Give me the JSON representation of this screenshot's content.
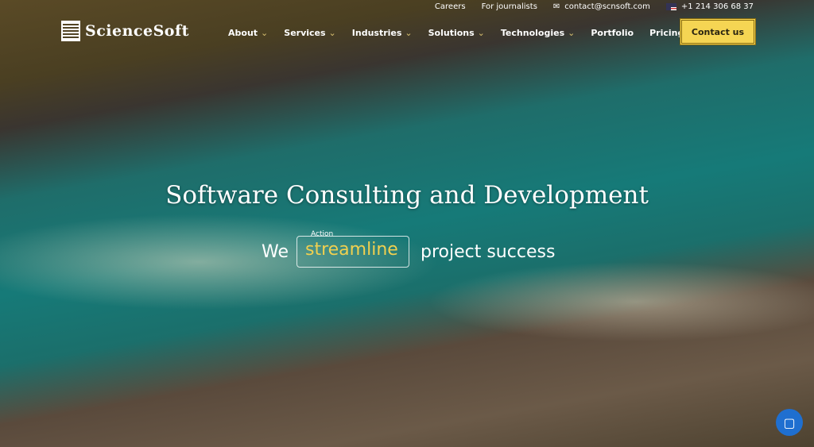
{
  "topbar": {
    "careers": "Careers",
    "journalists": "For journalists",
    "email": "contact@scnsoft.com",
    "phone": "+1 214 306 68 37"
  },
  "logo": "ScienceSoft",
  "nav": [
    {
      "label": "About",
      "dropdown": true
    },
    {
      "label": "Services",
      "dropdown": true
    },
    {
      "label": "Industries",
      "dropdown": true
    },
    {
      "label": "Solutions",
      "dropdown": true
    },
    {
      "label": "Technologies",
      "dropdown": true
    },
    {
      "label": "Portfolio",
      "dropdown": false
    },
    {
      "label": "Pricing",
      "dropdown": false
    }
  ],
  "contact_button": "Contact us",
  "hero": {
    "title": "Software Consulting and Development",
    "prefix": "We",
    "box_label": "Action",
    "word": "streamline",
    "suffix": "project success"
  },
  "colors": {
    "accent": "#f5d553",
    "chat": "#1f6fd0"
  }
}
